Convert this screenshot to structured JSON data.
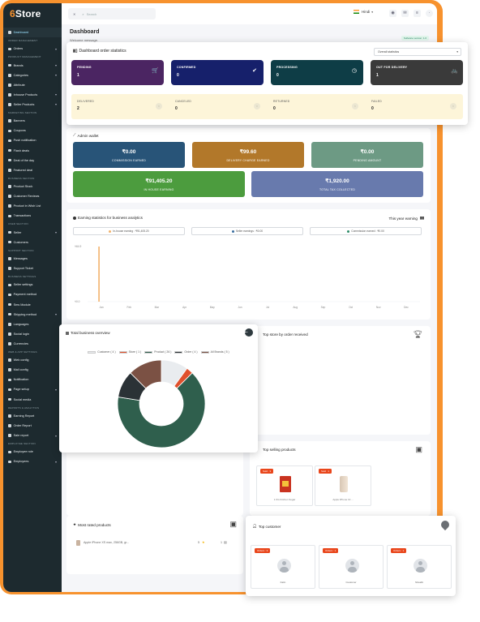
{
  "brand": {
    "logo_prefix": "6",
    "logo_name": "Store",
    "accent": "#f7922e",
    "sidebar_bg": "#1d2a2f"
  },
  "topbar": {
    "search_placeholder": "Search",
    "language": "Hindi"
  },
  "sidebar": [
    {
      "type": "item",
      "label": "Dashboard",
      "active": true
    },
    {
      "type": "section",
      "label": "ORDER MANAGEMENT"
    },
    {
      "type": "item",
      "label": "Orders",
      "chevron": true
    },
    {
      "type": "section",
      "label": "PRODUCT MANAGEMENT"
    },
    {
      "type": "item",
      "label": "Brands",
      "chevron": true
    },
    {
      "type": "item",
      "label": "Categories",
      "chevron": true
    },
    {
      "type": "item",
      "label": "Attribute"
    },
    {
      "type": "item",
      "label": "Inhouse Products",
      "chevron": true
    },
    {
      "type": "item",
      "label": "Seller Products",
      "chevron": true
    },
    {
      "type": "section",
      "label": "MARKETING SECTION"
    },
    {
      "type": "item",
      "label": "Banners"
    },
    {
      "type": "item",
      "label": "Coupons"
    },
    {
      "type": "item",
      "label": "Push notification"
    },
    {
      "type": "item",
      "label": "Flash deals"
    },
    {
      "type": "item",
      "label": "Deal of the day"
    },
    {
      "type": "item",
      "label": "Featured deal"
    },
    {
      "type": "section",
      "label": "BUSINESS SECTION"
    },
    {
      "type": "item",
      "label": "Product Stock"
    },
    {
      "type": "item",
      "label": "Customer Reviews"
    },
    {
      "type": "item",
      "label": "Product in Wish List"
    },
    {
      "type": "item",
      "label": "Transactions"
    },
    {
      "type": "section",
      "label": "USER SECTION"
    },
    {
      "type": "item",
      "label": "Seller",
      "chevron": true
    },
    {
      "type": "item",
      "label": "Customers"
    },
    {
      "type": "section",
      "label": "SUPPORT SECTION"
    },
    {
      "type": "item",
      "label": "Messages"
    },
    {
      "type": "item",
      "label": "Support Ticket"
    },
    {
      "type": "section",
      "label": "BUSINESS SETTINGS"
    },
    {
      "type": "item",
      "label": "Seller settings"
    },
    {
      "type": "item",
      "label": "Payment method"
    },
    {
      "type": "item",
      "label": "Sms Module"
    },
    {
      "type": "item",
      "label": "Shipping method",
      "chevron": true
    },
    {
      "type": "item",
      "label": "Languages"
    },
    {
      "type": "item",
      "label": "Social login"
    },
    {
      "type": "item",
      "label": "Currencies"
    },
    {
      "type": "section",
      "label": "WEB & APP SETTINGS"
    },
    {
      "type": "item",
      "label": "Web config"
    },
    {
      "type": "item",
      "label": "Mail config"
    },
    {
      "type": "item",
      "label": "Notification"
    },
    {
      "type": "item",
      "label": "Page setup",
      "chevron": true
    },
    {
      "type": "item",
      "label": "Social media"
    },
    {
      "type": "section",
      "label": "REPORTS & ANALYTICS"
    },
    {
      "type": "item",
      "label": "Earning Report"
    },
    {
      "type": "item",
      "label": "Order Report"
    },
    {
      "type": "item",
      "label": "Sale report",
      "chevron": true
    },
    {
      "type": "section",
      "label": "EMPLOYEE SECTION"
    },
    {
      "type": "item",
      "label": "Employee role"
    },
    {
      "type": "item",
      "label": "Employees",
      "chevron": true
    }
  ],
  "header": {
    "title": "Dashboard",
    "subtitle": "Welcome message.",
    "version": "Software version: 1.0"
  },
  "order_stats": {
    "title": "Dashboard order statistics",
    "filter": "Overall statistics",
    "primary": [
      {
        "label": "PENDING",
        "value": "1",
        "color": "#4b2562",
        "icon": "🛒"
      },
      {
        "label": "CONFIRMED",
        "value": "0",
        "color": "#16206b",
        "icon": "✔"
      },
      {
        "label": "PROCESSING",
        "value": "0",
        "color": "#0e3d46",
        "icon": "◷"
      },
      {
        "label": "OUT FOR DELIVERY",
        "value": "1",
        "color": "#3a3a3a",
        "icon": "🚲"
      }
    ],
    "secondary": [
      {
        "label": "DELIVERED",
        "value": "2"
      },
      {
        "label": "CANCELED",
        "value": "0"
      },
      {
        "label": "RETURNED",
        "value": "0"
      },
      {
        "label": "FAILED",
        "value": "0"
      }
    ]
  },
  "wallet": {
    "title": "Admin wallet",
    "boxes": [
      {
        "amount": "₹0.00",
        "caption": "COMMISSION EARNED",
        "color": "#285478"
      },
      {
        "amount": "₹99.60",
        "caption": "DELIVERY CHARGE EARNED",
        "color": "#b2782a"
      },
      {
        "amount": "₹0.00",
        "caption": "PENDING AMOUNT",
        "color": "#6d9a84"
      },
      {
        "amount": "₹91,405.20",
        "caption": "IN HOUSE EARNING",
        "color": "#4c9c3e"
      },
      {
        "amount": "₹1,920.00",
        "caption": "TOTAL TAX COLLECTED",
        "color": "#687aad"
      }
    ]
  },
  "earning_chart": {
    "title": "Earning statistics for business analytics",
    "period": "This year earning",
    "legend": [
      {
        "label": "In-house earning : ₹91,405.20",
        "color": "#f2b26b"
      },
      {
        "label": "Seller earnings : ₹0.00",
        "color": "#3c6fa0"
      },
      {
        "label": "Commission earned : ₹0.00",
        "color": "#2e8d6a"
      }
    ]
  },
  "chart_data": {
    "type": "bar",
    "categories": [
      "Jan",
      "Feb",
      "Mar",
      "Apr",
      "May",
      "Jun",
      "Jul",
      "Aug",
      "Sep",
      "Oct",
      "Nov",
      "Dec"
    ],
    "series": [
      {
        "name": "In-house earning",
        "values": [
          91405.2,
          0,
          0,
          0,
          0,
          0,
          0,
          0,
          0,
          0,
          0,
          0
        ],
        "color": "#f2b26b"
      },
      {
        "name": "Seller earnings",
        "values": [
          0,
          0,
          0,
          0,
          0,
          0,
          0,
          0,
          0,
          0,
          0,
          0
        ],
        "color": "#3c6fa0"
      },
      {
        "name": "Commission earned",
        "values": [
          0,
          0,
          0,
          0,
          0,
          0,
          0,
          0,
          0,
          0,
          0,
          0
        ],
        "color": "#2e8d6a"
      }
    ],
    "y_tick_labels": [
      "₹0.0",
      "₹64.9"
    ],
    "ylim": [
      0,
      91405.2
    ]
  },
  "business_overview": {
    "title": "Total business overview",
    "legend": [
      {
        "label": "Customer ( 4 )",
        "value": 4,
        "color": "#e9ecef"
      },
      {
        "label": "Store ( 1 )",
        "value": 1,
        "color": "#e0502c"
      },
      {
        "label": "Product ( 26 )",
        "value": 26,
        "color": "#2f5f4d"
      },
      {
        "label": "Order ( 4 )",
        "value": 4,
        "color": "#2b3236"
      },
      {
        "label": "All Brands ( 5 )",
        "value": 5,
        "color": "#7b5144"
      }
    ]
  },
  "top_store": {
    "title": "Top store by order received"
  },
  "top_selling": {
    "title": "Top selling products",
    "items": [
      {
        "badge": "Sold : 3",
        "name": "1 KG Kitchen Sugar"
      },
      {
        "badge": "Sold : 1",
        "name": "Apple iPhone 13 ..."
      }
    ]
  },
  "most_rated": {
    "title": "Most rated products",
    "rows": [
      {
        "name": "Apple iPhone XS max, 256GB, gr...",
        "rating": "5",
        "reviews": "1"
      }
    ]
  },
  "top_customer": {
    "title": "Top customer",
    "items": [
      {
        "badge": "Orders : 3",
        "name": "Fatin"
      },
      {
        "badge": "Orders : 1",
        "name": "Customer"
      },
      {
        "badge": "Orders : 1",
        "name": "Shoaibi"
      }
    ]
  }
}
